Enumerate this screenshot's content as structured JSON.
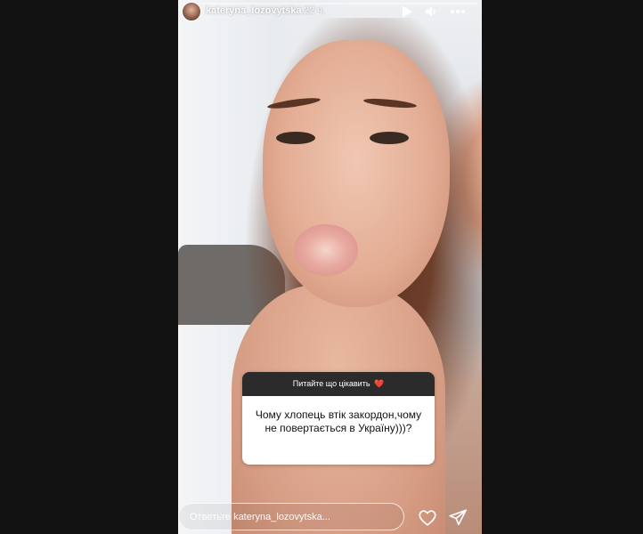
{
  "story": {
    "progress": 0.0,
    "user": {
      "username": "kateryna_lozovytska",
      "time_ago": "22 ч."
    },
    "controls": {
      "play_icon": "play-icon",
      "sound_icon": "volume-icon",
      "more_icon": "more-dots-icon"
    },
    "question_sticker": {
      "title": "Питайте що цікавить",
      "title_emoji": "❤️",
      "text": "Чому хлопець втік закордон,чому не повертається в Україну)))?"
    },
    "reply": {
      "placeholder": "Ответьте kateryna_lozovytska...",
      "value": ""
    },
    "actions": {
      "like_icon": "heart-icon",
      "share_icon": "send-icon"
    }
  },
  "colors": {
    "page_bg": "#000000",
    "side_bg": "#121212",
    "sticker_header": "#2b2b2b",
    "heart": "#e8524b"
  }
}
